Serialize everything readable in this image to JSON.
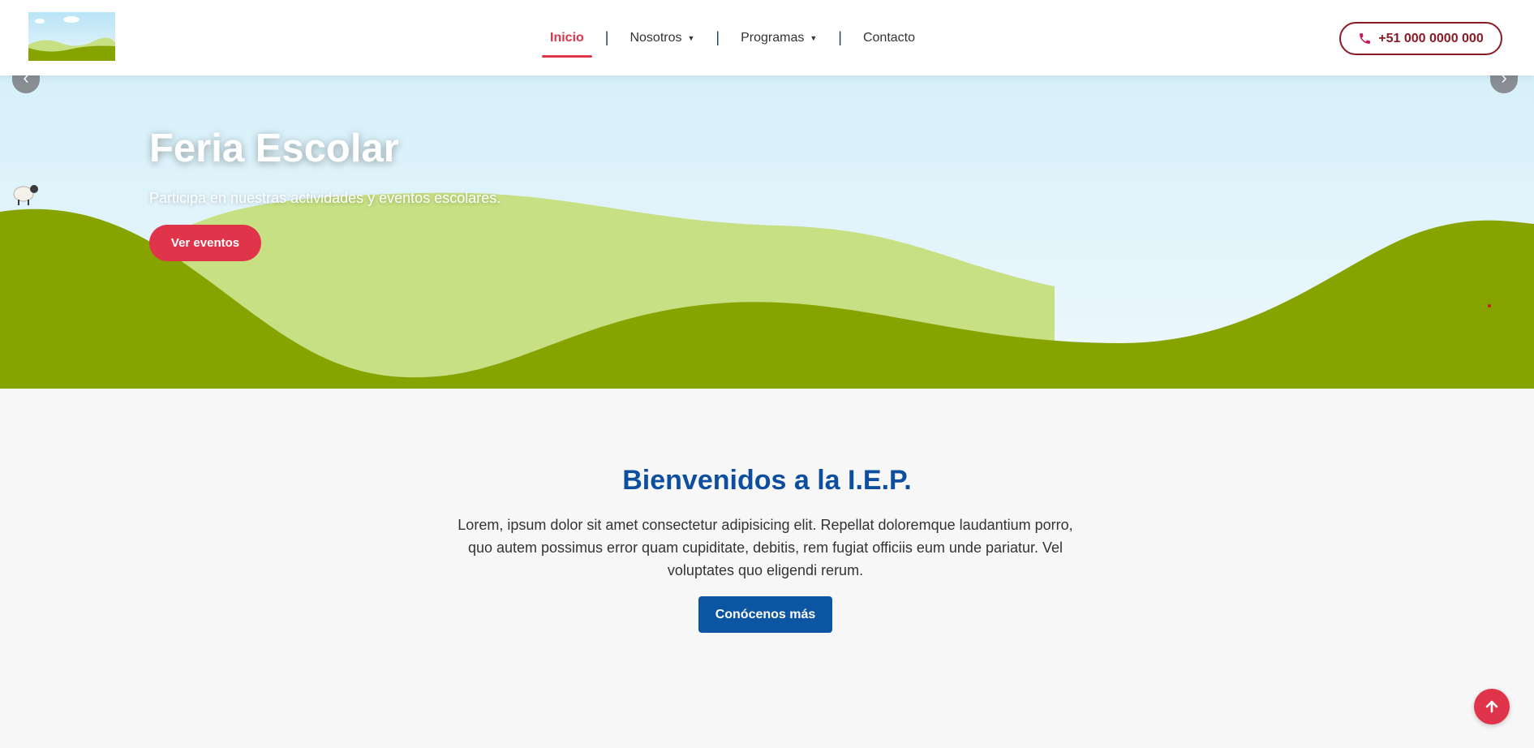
{
  "nav": {
    "items": [
      {
        "label": "Inicio",
        "active": true
      },
      {
        "label": "Nosotros",
        "dropdown": true
      },
      {
        "label": "Programas",
        "dropdown": true
      },
      {
        "label": "Contacto"
      }
    ],
    "separator": "|",
    "caret": "▼"
  },
  "header": {
    "phone": "+51 000 0000 000"
  },
  "hero": {
    "title": "Feria Escolar",
    "subtitle": "Participa en nuestras actividades y eventos escolares.",
    "button_label": "Ver eventos",
    "prev_arrow": "‹",
    "next_arrow": "›"
  },
  "welcome": {
    "title": "Bienvenidos a la I.E.P.",
    "text": "Lorem, ipsum dolor sit amet consectetur adipisicing elit. Repellat doloremque laudantium porro, quo autem possimus error quam cupiditate, debitis, rem fugiat officiis eum unde pariatur. Vel voluptates quo eligendi rerum.",
    "button_label": "Conócenos más"
  },
  "colors": {
    "accent": "#e0344a",
    "primary_blue": "#0c55a3",
    "phone_border": "#8b1a26",
    "grass_dark": "#86a300",
    "grass_light": "#c6e083",
    "sky": "#dff3fb"
  },
  "icons": {
    "phone": "phone-icon",
    "scroll_top": "arrow-up-icon",
    "sheep": "sheep-icon"
  }
}
